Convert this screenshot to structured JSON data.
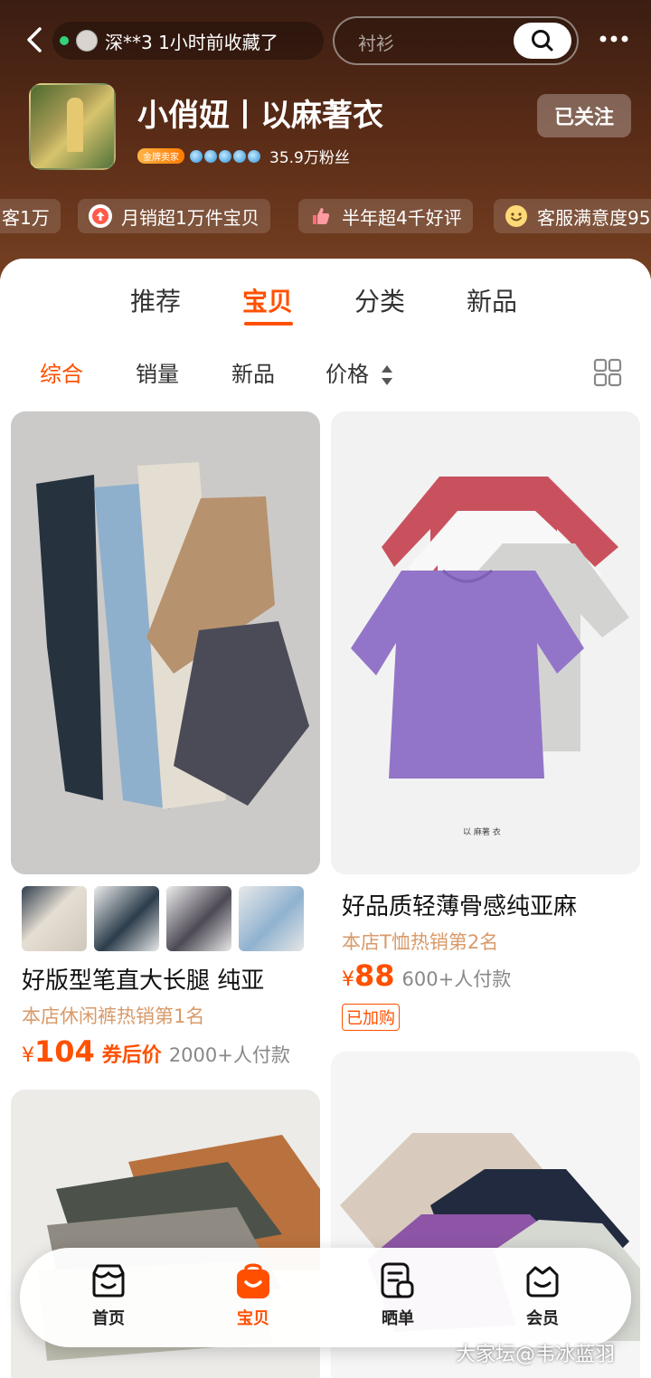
{
  "topbar": {
    "notice_text": "深**3 1小时前收藏了",
    "search_placeholder": "衬衫"
  },
  "shop": {
    "name": "小俏妞丨以麻著衣",
    "badge_label": "金牌卖家",
    "fans": "35.9万粉丝",
    "follow_label": "已关注"
  },
  "chips": [
    {
      "label": "客1万",
      "icon": "none"
    },
    {
      "label": "月销超1万件宝贝",
      "icon": "up-arrow-icon"
    },
    {
      "label": "半年超4千好评",
      "icon": "thumbs-up-icon"
    },
    {
      "label": "客服满意度95",
      "icon": "smile-icon"
    }
  ],
  "tabs": [
    {
      "label": "推荐",
      "active": false
    },
    {
      "label": "宝贝",
      "active": true
    },
    {
      "label": "分类",
      "active": false
    },
    {
      "label": "新品",
      "active": false
    }
  ],
  "sorts": [
    {
      "label": "综合",
      "active": true
    },
    {
      "label": "销量",
      "active": false
    },
    {
      "label": "新品",
      "active": false
    },
    {
      "label": "价格",
      "active": false
    }
  ],
  "products": [
    {
      "title": "好版型笔直大长腿 纯亚",
      "rank": "本店休闲裤热销第1名",
      "currency": "¥",
      "price": "104",
      "coupon_label": "券后价",
      "sold": "2000+人付款"
    },
    {
      "title": "好品质轻薄骨感纯亚麻",
      "rank": "本店T恤热销第2名",
      "currency": "¥",
      "price": "88",
      "sold": "600+人付款",
      "cart_tag": "已加购",
      "image_logo": "以 麻著 衣"
    }
  ],
  "bottom_nav": [
    {
      "label": "首页",
      "icon": "home-icon",
      "active": false
    },
    {
      "label": "宝贝",
      "icon": "bag-icon",
      "active": true
    },
    {
      "label": "晒单",
      "icon": "review-icon",
      "active": false
    },
    {
      "label": "会员",
      "icon": "member-icon",
      "active": false
    }
  ],
  "watermark": "大家坛@韦冰蓝羽",
  "colors": {
    "accent": "#ff5000",
    "header_brown": "#5a2c17",
    "rank_text": "#d89a6a"
  }
}
